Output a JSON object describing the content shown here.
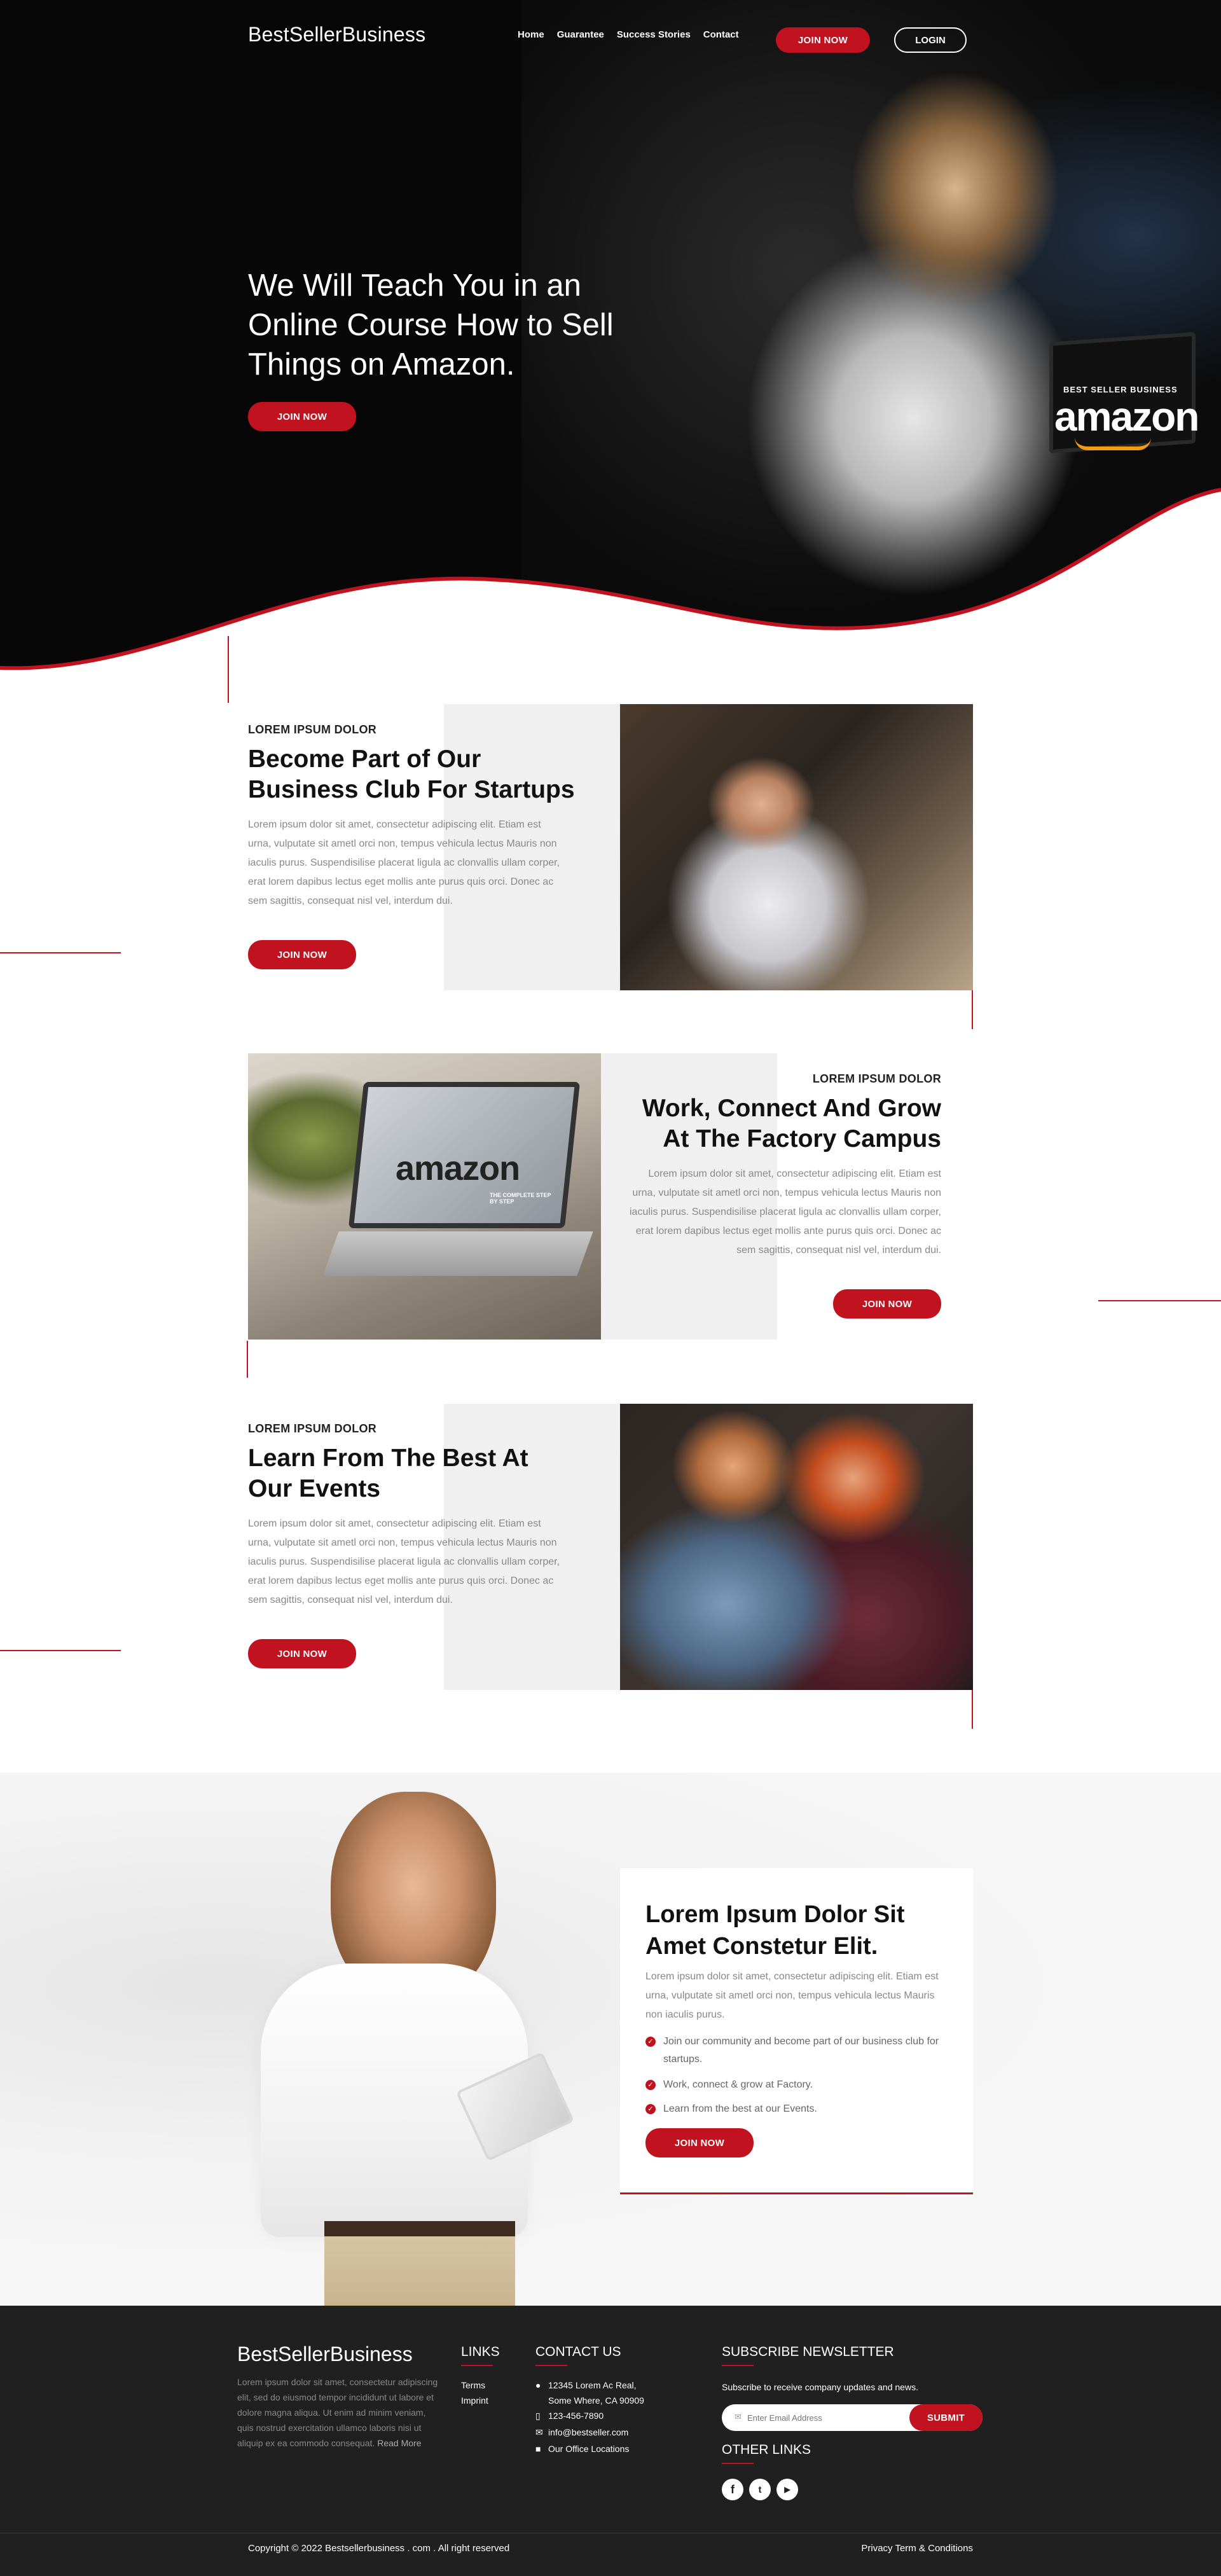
{
  "brand": "BestSellerBusiness",
  "nav": {
    "items": [
      "Home",
      "Guarantee",
      "Success Stories",
      "Contact"
    ],
    "join_label": "JOIN NOW",
    "login_label": "LOGIN"
  },
  "hero": {
    "title": "We Will Teach You in an Online Course How to Sell Things on Amazon.",
    "cta": "JOIN NOW",
    "laptop_caption": "BEST SELLER BUSINESS",
    "laptop_logo": "amazon"
  },
  "sections": [
    {
      "kicker": "LOREM IPSUM DOLOR",
      "title": "Become Part of Our Business Club For Startups",
      "body": "Lorem ipsum dolor sit amet, consectetur adipiscing elit. Etiam est urna, vulputate sit ametl orci non, tempus vehicula lectus Mauris non iaculis purus. Suspendisilise placerat ligula ac clonvallis ullam corper, erat lorem dapibus lectus eget mollis ante purus quis orci. Donec ac sem sagittis, consequat nisl vel, interdum dui.",
      "cta": "JOIN NOW"
    },
    {
      "kicker": "LOREM IPSUM DOLOR",
      "title": "Work, Connect And Grow At The Factory Campus",
      "body": "Lorem ipsum dolor sit amet, consectetur adipiscing elit. Etiam est urna, vulputate sit ametl orci non, tempus vehicula lectus Mauris non iaculis purus. Suspendisilise placerat ligula ac clonvallis ullam corper, erat lorem dapibus lectus eget mollis ante purus quis orci. Donec ac sem sagittis, consequat nisl vel, interdum dui.",
      "cta": "JOIN NOW",
      "laptop_logo": "amazon",
      "laptop_tag": "THE COMPLETE STEP BY STEP"
    },
    {
      "kicker": "LOREM IPSUM DOLOR",
      "title": "Learn From The Best At Our Events",
      "body": "Lorem ipsum dolor sit amet, consectetur adipiscing elit. Etiam est urna, vulputate sit ametl orci non, tempus vehicula lectus Mauris non iaculis purus. Suspendisilise placerat ligula ac clonvallis ullam corper, erat lorem dapibus lectus eget mollis ante purus quis orci. Donec ac sem sagittis, consequat nisl vel, interdum dui.",
      "cta": "JOIN NOW"
    }
  ],
  "promo": {
    "title": "Lorem Ipsum Dolor Sit Amet Constetur Elit.",
    "body": "Lorem ipsum dolor sit amet, consectetur adipiscing elit. Etiam est urna, vulputate sit ametl orci non, tempus vehicula lectus Mauris non iaculis purus.",
    "checks": [
      "Join our community and become part of our business club for startups.",
      "Work, connect & grow at Factory.",
      "Learn from the best at our Events."
    ],
    "cta": "JOIN NOW"
  },
  "footer": {
    "brand": "BestSellerBusiness",
    "about": "Lorem ipsum dolor sit amet, consectetur adipiscing elit, sed do eiusmod tempor incididunt ut labore et dolore magna aliqua. Ut enim ad minim veniam, quis nostrud exercitation ullamco laboris nisi ut aliquip ex ea commodo consequat.",
    "read_more": "Read More",
    "links_heading": "LINKS",
    "links": [
      "Terms",
      "Imprint"
    ],
    "contact_heading": "CONTACT US",
    "address_line1": "12345 Lorem Ac Real,",
    "address_line2": "Some Where, CA 90909",
    "phone": "123-456-7890",
    "email": "info@bestseller.com",
    "offices": "Our Office Locations",
    "newsletter_heading": "SUBSCRIBE NEWSLETTER",
    "newsletter_text": "Subscribe to receive company updates and news.",
    "email_placeholder": "Enter Email Address",
    "submit_label": "SUBMIT",
    "other_links_heading": "OTHER LINKS",
    "copyright": "Copyright © 2022 Bestsellerbusiness . com . All right reserved",
    "legal": "Privacy Term & Conditions"
  },
  "colors": {
    "accent": "#c1121f",
    "hero_bg": "#070707",
    "footer_bg": "#202020",
    "block_grey": "#f0f0f0"
  }
}
